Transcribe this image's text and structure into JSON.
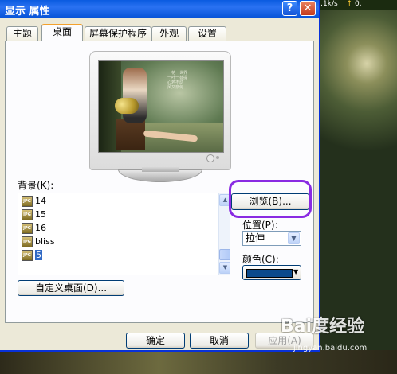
{
  "window": {
    "title": "显示 属性",
    "help_label": "?",
    "close_label": "✕"
  },
  "tray": {
    "speed_down": "0.1k/s",
    "speed_up": "0."
  },
  "tabs": [
    {
      "label": "主题"
    },
    {
      "label": "桌面"
    },
    {
      "label": "屏幕保护程序"
    },
    {
      "label": "外观"
    },
    {
      "label": "设置"
    }
  ],
  "active_tab": "桌面",
  "preview": {
    "poem_lines": [
      "一花一世界",
      "一叶一菩提",
      "心若不动",
      "风又奈何"
    ]
  },
  "background": {
    "label": "背景(K):",
    "items": [
      {
        "icon": "jpg-icon",
        "text": "14",
        "selected": false
      },
      {
        "icon": "jpg-icon",
        "text": "15",
        "selected": false
      },
      {
        "icon": "jpg-icon",
        "text": "16",
        "selected": false
      },
      {
        "icon": "jpg-icon",
        "text": "bliss",
        "selected": false
      },
      {
        "icon": "jpg-icon",
        "text": "5",
        "selected": true
      }
    ],
    "icon_text": "JPG"
  },
  "buttons": {
    "browse": "浏览(B)...",
    "customize": "自定义桌面(D)...",
    "ok": "确定",
    "cancel": "取消",
    "apply": "应用(A)"
  },
  "position": {
    "label": "位置(P):",
    "selected": "拉伸"
  },
  "color": {
    "label": "颜色(C):",
    "value": "#0a4a8c"
  },
  "watermark": {
    "text": "Bai度经验",
    "url": "jingyan.baidu.com"
  },
  "colors": {
    "highlight": "#8a2be2",
    "selection": "#316ac5",
    "titlebar": "#0a5be0"
  }
}
